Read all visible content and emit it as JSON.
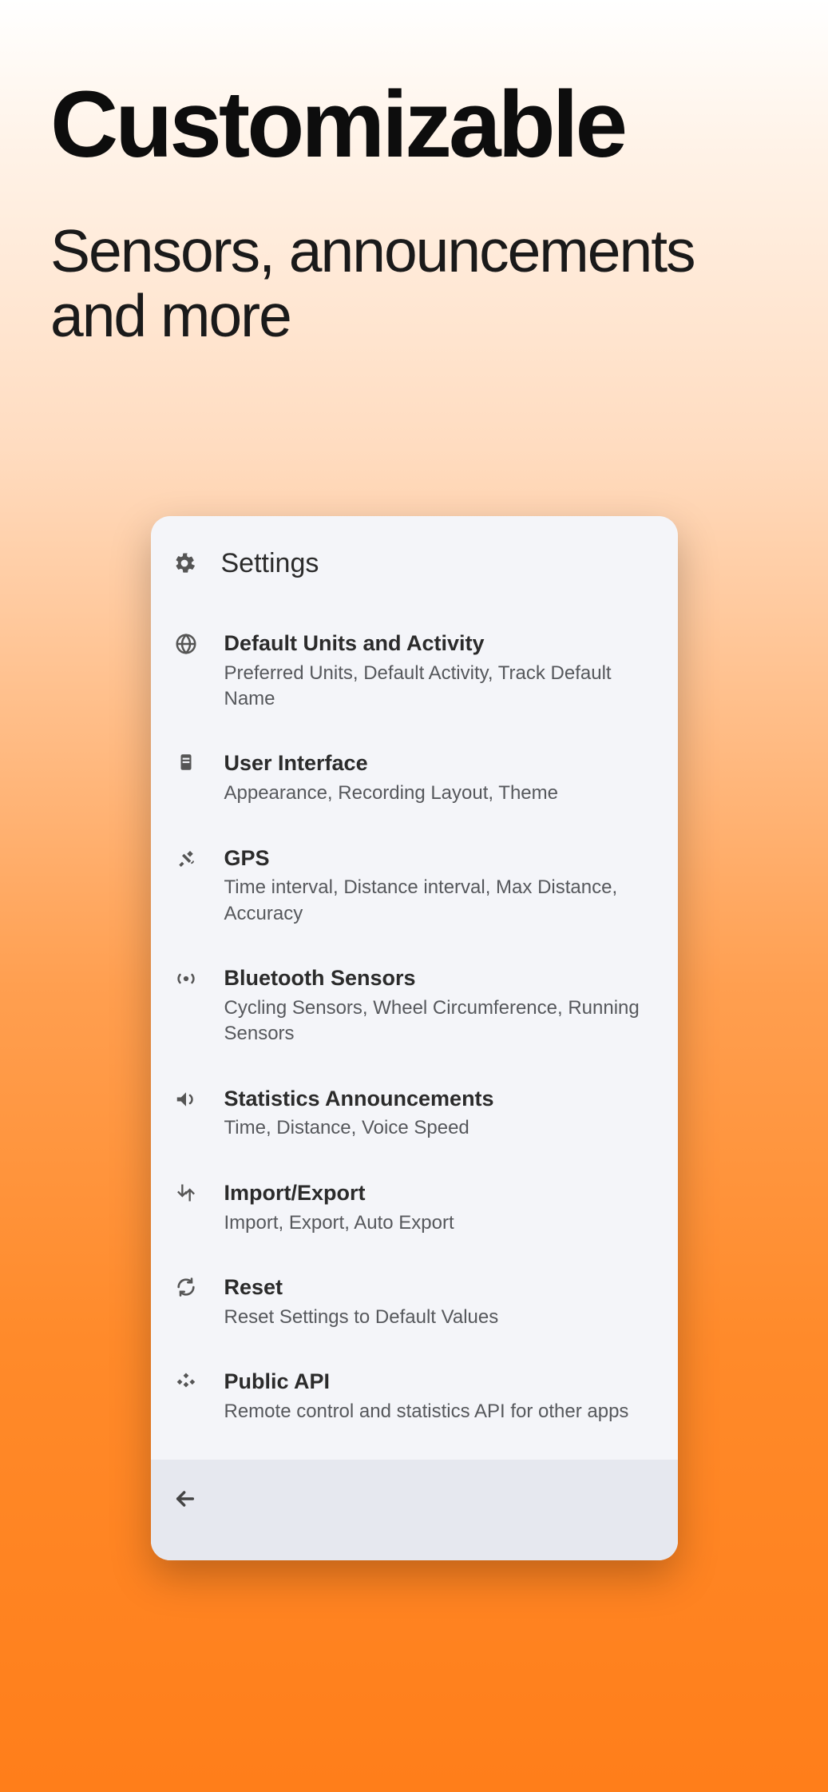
{
  "hero": {
    "title": "Customizable",
    "subtitle": "Sensors, announcements and more"
  },
  "settings": {
    "header": {
      "title": "Settings"
    },
    "items": [
      {
        "title": "Default Units and Activity",
        "subtitle": "Preferred Units, Default Activity, Track Default Name"
      },
      {
        "title": "User Interface",
        "subtitle": "Appearance, Recording Layout, Theme"
      },
      {
        "title": "GPS",
        "subtitle": "Time interval, Distance interval, Max Distance, Accuracy"
      },
      {
        "title": "Bluetooth Sensors",
        "subtitle": "Cycling Sensors, Wheel Circumference, Running Sensors"
      },
      {
        "title": "Statistics Announcements",
        "subtitle": "Time, Distance, Voice Speed"
      },
      {
        "title": "Import/Export",
        "subtitle": "Import, Export, Auto Export"
      },
      {
        "title": "Reset",
        "subtitle": "Reset Settings to Default Values"
      },
      {
        "title": "Public API",
        "subtitle": "Remote control and statistics API for other apps"
      }
    ]
  }
}
